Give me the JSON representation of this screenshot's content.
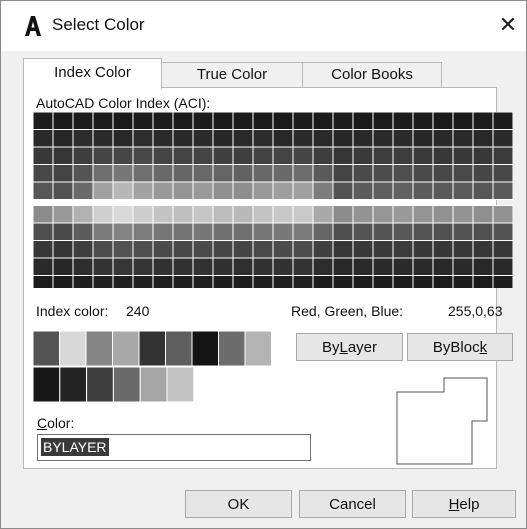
{
  "window": {
    "title": "Select Color",
    "close_symbol": "✕"
  },
  "tabs": [
    {
      "label": "Index Color",
      "active": true
    },
    {
      "label": "True Color",
      "active": false
    },
    {
      "label": "Color Books",
      "active": false
    }
  ],
  "aci_label": "AutoCAD Color Index (ACI):",
  "palette": {
    "top_rows": [
      [
        "#1d1d1d",
        "#1a1a1a",
        "#1c1c1c",
        "#1b1b1b",
        "#1a1a1a",
        "#1d1d1d",
        "#1c1c1c",
        "#1b1b1b",
        "#1d1d1d",
        "#1a1a1a",
        "#1c1c1c",
        "#1b1b1b",
        "#1a1a1a",
        "#1d1d1d",
        "#1b1b1b",
        "#1c1c1c",
        "#1a1a1a",
        "#1b1b1b",
        "#1d1d1d",
        "#1c1c1c",
        "#1b1b1b",
        "#1a1a1a",
        "#1c1c1c",
        "#1d1d1d"
      ],
      [
        "#2a2a2a",
        "#262626",
        "#2c2c2c",
        "#2b2b2b",
        "#282828",
        "#2d2d2d",
        "#2a2a2a",
        "#292929",
        "#2b2b2b",
        "#272727",
        "#2a2a2a",
        "#2c2c2c",
        "#282828",
        "#2b2b2b",
        "#2a2a2a",
        "#262626",
        "#292929",
        "#2a2a2a",
        "#2b2b2b",
        "#272727",
        "#292929",
        "#2a2a2a",
        "#282828",
        "#2b2b2b"
      ],
      [
        "#393939",
        "#363636",
        "#3e3e3e",
        "#444444",
        "#464646",
        "#484848",
        "#454545",
        "#434343",
        "#444444",
        "#404040",
        "#3f3f3f",
        "#424242",
        "#444444",
        "#454545",
        "#3e3e3e",
        "#363636",
        "#3a3a3a",
        "#3c3c3c",
        "#3d3d3d",
        "#3a3a3a",
        "#383838",
        "#393939",
        "#383838",
        "#3b3b3b"
      ],
      [
        "#474747",
        "#434343",
        "#545454",
        "#6e6e6e",
        "#777777",
        "#6f6f6f",
        "#696969",
        "#666666",
        "#686868",
        "#646464",
        "#626262",
        "#676767",
        "#6a6a6a",
        "#6d6d6d",
        "#5a5a5a",
        "#444444",
        "#4a4a4a",
        "#4c4c4c",
        "#4e4e4e",
        "#4a4a4a",
        "#474747",
        "#494949",
        "#464646",
        "#484848"
      ],
      [
        "#575757",
        "#525252",
        "#6a6a6a",
        "#a1a1a1",
        "#b7b7b7",
        "#a3a3a3",
        "#999999",
        "#949494",
        "#9a9a9a",
        "#8f8f8f",
        "#8e8e8e",
        "#999999",
        "#9e9e9e",
        "#a0a0a0",
        "#7d7d7d",
        "#525252",
        "#5c5c5c",
        "#5e5e5e",
        "#616161",
        "#5c5c5c",
        "#595959",
        "#5b5b5b",
        "#575757",
        "#595959"
      ]
    ],
    "bottom_rows": [
      [
        "#8c8c8c",
        "#999999",
        "#b1b1b1",
        "#cfcfcf",
        "#d9d9d9",
        "#cdcdcd",
        "#c4c4c4",
        "#bfbfbf",
        "#c6c6c6",
        "#bcbcbc",
        "#b9b9b9",
        "#c3c3c3",
        "#c7c7c7",
        "#c9c9c9",
        "#a9a9a9",
        "#8c8c8c",
        "#939393",
        "#969696",
        "#999999",
        "#949494",
        "#919191",
        "#939393",
        "#8f8f8f",
        "#929292"
      ],
      [
        "#4f4f4f",
        "#4a4a4a",
        "#5c5c5c",
        "#7a7a7a",
        "#848484",
        "#7c7c7c",
        "#767676",
        "#737373",
        "#777777",
        "#717171",
        "#6f6f6f",
        "#757575",
        "#787878",
        "#7a7a7a",
        "#666666",
        "#4e4e4e",
        "#545454",
        "#565656",
        "#585858",
        "#545454",
        "#515151",
        "#535353",
        "#505050",
        "#525252"
      ],
      [
        "#383838",
        "#343434",
        "#3d3d3d",
        "#4d4d4d",
        "#525252",
        "#4e4e4e",
        "#4a4a4a",
        "#484848",
        "#4a4a4a",
        "#464646",
        "#454545",
        "#494949",
        "#4b4b4b",
        "#4c4c4c",
        "#404040",
        "#363636",
        "#393939",
        "#3a3a3a",
        "#3b3b3b",
        "#393939",
        "#373737",
        "#383838",
        "#363636",
        "#373737"
      ],
      [
        "#2a2a2a",
        "#272727",
        "#2d2d2d",
        "#333333",
        "#363636",
        "#343434",
        "#323232",
        "#313131",
        "#323232",
        "#303030",
        "#2f2f2f",
        "#313131",
        "#323232",
        "#333333",
        "#2d2d2d",
        "#282828",
        "#2a2a2a",
        "#2b2b2b",
        "#2b2b2b",
        "#2a2a2a",
        "#292929",
        "#2a2a2a",
        "#282828",
        "#292929"
      ],
      [
        "#1c1c1c",
        "#1a1a1a",
        "#1d1d1d",
        "#1f1f1f",
        "#202020",
        "#1f1f1f",
        "#1e1e1e",
        "#1e1e1e",
        "#1e1e1e",
        "#1d1d1d",
        "#1d1d1d",
        "#1e1e1e",
        "#1e1e1e",
        "#1f1f1f",
        "#1c1c1c",
        "#1b1b1b",
        "#1c1c1c",
        "#1c1c1c",
        "#1c1c1c",
        "#1c1c1c",
        "#1b1b1b",
        "#1c1c1c",
        "#1b1b1b",
        "#1c1c1c"
      ]
    ],
    "standard_row": [
      "#545454",
      "#d8d8d8",
      "#868686",
      "#a8a8a8",
      "#333333",
      "#5e5e5e",
      "#141414",
      "#6c6c6c",
      "#b4b4b4"
    ],
    "gray_row": [
      "#181818",
      "#232323",
      "#3e3e3e",
      "#6a6a6a",
      "#a6a6a6",
      "#c4c4c4"
    ]
  },
  "info": {
    "index_label": "Index color:",
    "index_value": "240",
    "rgb_label": "Red, Green, Blue:",
    "rgb_value": "255,0,63"
  },
  "buttons": {
    "bylayer": {
      "pre": "By",
      "key": "L",
      "post": "ayer"
    },
    "byblock": {
      "pre": "ByBloc",
      "key": "k",
      "post": ""
    },
    "ok": "OK",
    "cancel": "Cancel",
    "help": {
      "pre": "",
      "key": "H",
      "post": "elp"
    }
  },
  "color_field": {
    "label_key": "C",
    "label_rest": "olor:",
    "value": "BYLAYER"
  }
}
